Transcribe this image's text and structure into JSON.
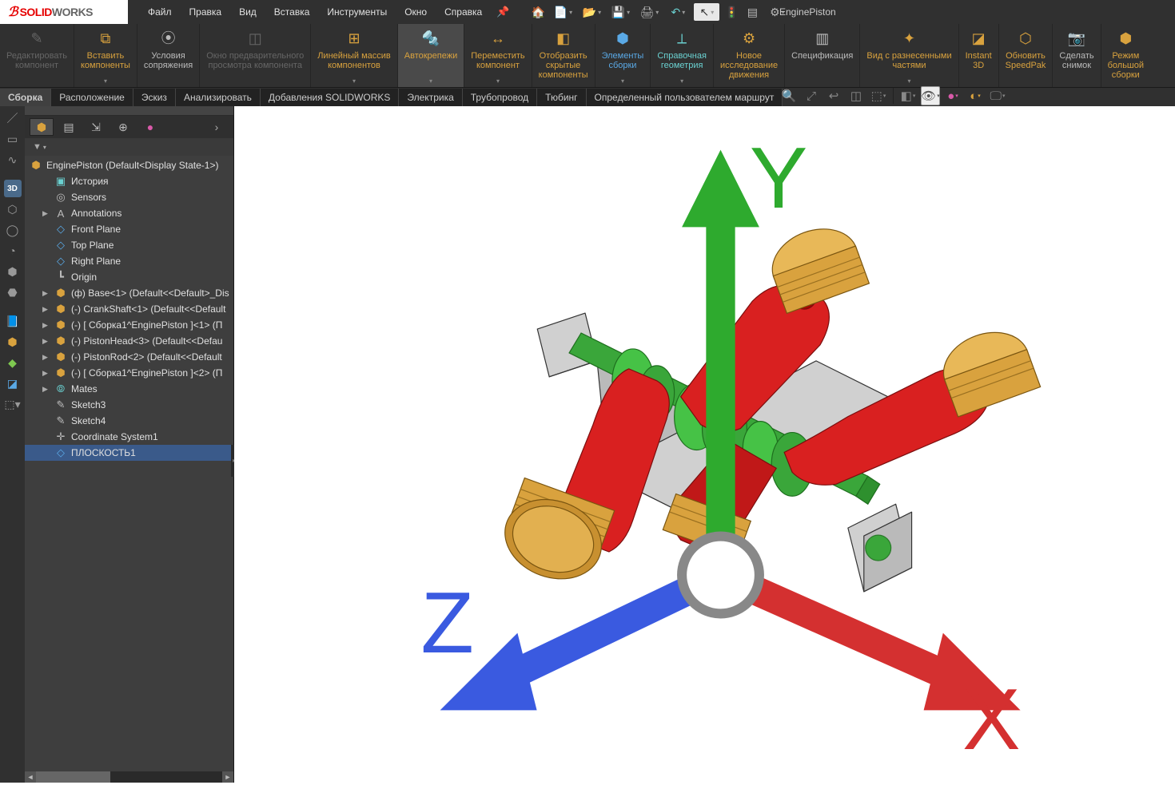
{
  "app": {
    "title": "EnginePiston"
  },
  "logo": {
    "brand1": "SOLID",
    "brand2": "WORKS"
  },
  "top_menu": [
    "Файл",
    "Правка",
    "Вид",
    "Вставка",
    "Инструменты",
    "Окно",
    "Справка"
  ],
  "ribbon": [
    {
      "label1": "Редактировать",
      "label2": "компонент",
      "icon": "✎",
      "cls": "disabled",
      "drop": false
    },
    {
      "label1": "Вставить",
      "label2": "компоненты",
      "icon": "⧉",
      "cls": "gold",
      "drop": true
    },
    {
      "label1": "Условия",
      "label2": "сопряжения",
      "icon": "⦿",
      "cls": "",
      "drop": false
    },
    {
      "label1": "Окно предварительного",
      "label2": "просмотра компонента",
      "icon": "◫",
      "cls": "disabled",
      "drop": false
    },
    {
      "label1": "Линейный массив",
      "label2": "компонентов",
      "icon": "⊞",
      "cls": "gold",
      "drop": true
    },
    {
      "label1": "Автокрепежи",
      "label2": "",
      "icon": "🔩",
      "cls": "selected gold",
      "drop": true
    },
    {
      "label1": "Переместить",
      "label2": "компонент",
      "icon": "↔",
      "cls": "gold",
      "drop": true
    },
    {
      "label1": "Отобразить",
      "label2": "скрытые",
      "label3": "компоненты",
      "icon": "◧",
      "cls": "gold",
      "drop": false
    },
    {
      "label1": "Элементы",
      "label2": "сборки",
      "icon": "⬢",
      "cls": "blue",
      "drop": true
    },
    {
      "label1": "Справочная",
      "label2": "геометрия",
      "icon": "⟂",
      "cls": "cyan",
      "drop": true
    },
    {
      "label1": "Новое",
      "label2": "исследование",
      "label3": "движения",
      "icon": "⚙",
      "cls": "gold",
      "drop": false
    },
    {
      "label1": "Спецификация",
      "label2": "",
      "icon": "▥",
      "cls": "",
      "drop": false
    },
    {
      "label1": "Вид с разнесенными",
      "label2": "частями",
      "icon": "✦",
      "cls": "gold",
      "drop": true
    },
    {
      "label1": "Instant",
      "label2": "3D",
      "icon": "◪",
      "cls": "gold",
      "drop": false
    },
    {
      "label1": "Обновить",
      "label2": "SpeedPak",
      "icon": "⬡",
      "cls": "gold",
      "drop": false
    },
    {
      "label1": "Сделать",
      "label2": "снимок",
      "icon": "📷",
      "cls": "",
      "drop": false
    },
    {
      "label1": "Режим",
      "label2": "большой",
      "label3": "сборки",
      "icon": "⬢",
      "cls": "gold",
      "drop": false
    }
  ],
  "tabs": [
    "Сборка",
    "Расположение",
    "Эскиз",
    "Анализировать",
    "Добавления SOLIDWORKS",
    "Электрика",
    "Трубопровод",
    "Тюбинг",
    "Определенный пользователем маршрут"
  ],
  "active_tab": 0,
  "tree_root": {
    "label": "EnginePiston  (Default<Display State-1>)"
  },
  "tree_items": [
    {
      "icon": "▣",
      "label": "История",
      "indent": 1,
      "color": "#6ad0d0"
    },
    {
      "icon": "◎",
      "label": "Sensors",
      "indent": 1,
      "color": "#bbb"
    },
    {
      "icon": "A",
      "label": "Annotations",
      "indent": 1,
      "arrow": true,
      "color": "#bbb"
    },
    {
      "icon": "◇",
      "label": "Front Plane",
      "indent": 1,
      "color": "#5aa9e6"
    },
    {
      "icon": "◇",
      "label": "Top Plane",
      "indent": 1,
      "color": "#5aa9e6"
    },
    {
      "icon": "◇",
      "label": "Right Plane",
      "indent": 1,
      "color": "#5aa9e6"
    },
    {
      "icon": "┗",
      "label": "Origin",
      "indent": 1,
      "color": "#bbb"
    },
    {
      "icon": "⬢",
      "label": "(ф) Base<1> (Default<<Default>_Dis",
      "indent": 1,
      "arrow": true,
      "color": "#d9a23e"
    },
    {
      "icon": "⬢",
      "label": "(-) CrankShaft<1> (Default<<Default",
      "indent": 1,
      "arrow": true,
      "color": "#d9a23e"
    },
    {
      "icon": "⬢",
      "label": "(-) [ Сборка1^EnginePiston ]<1> (П",
      "indent": 1,
      "arrow": true,
      "color": "#d9a23e",
      "sub": true
    },
    {
      "icon": "⬢",
      "label": "(-) PistonHead<3> (Default<<Defau",
      "indent": 1,
      "arrow": true,
      "color": "#d9a23e"
    },
    {
      "icon": "⬢",
      "label": "(-) PistonRod<2> (Default<<Default",
      "indent": 1,
      "arrow": true,
      "color": "#d9a23e"
    },
    {
      "icon": "⬢",
      "label": "(-) [ Сборка1^EnginePiston ]<2> (П",
      "indent": 1,
      "arrow": true,
      "color": "#d9a23e",
      "sub": true
    },
    {
      "icon": "⦾",
      "label": "Mates",
      "indent": 1,
      "arrow": true,
      "color": "#6ad0d0"
    },
    {
      "icon": "✎",
      "label": "Sketch3",
      "indent": 1,
      "color": "#bbb"
    },
    {
      "icon": "✎",
      "label": "Sketch4",
      "indent": 1,
      "color": "#bbb"
    },
    {
      "icon": "✛",
      "label": "Coordinate System1",
      "indent": 1,
      "color": "#bbb"
    },
    {
      "icon": "◇",
      "label": "ПЛОСКОСТЬ1",
      "indent": 1,
      "color": "#5aa9e6",
      "selected": true
    }
  ],
  "triad": {
    "x": "X",
    "y": "Y",
    "z": "Z"
  }
}
